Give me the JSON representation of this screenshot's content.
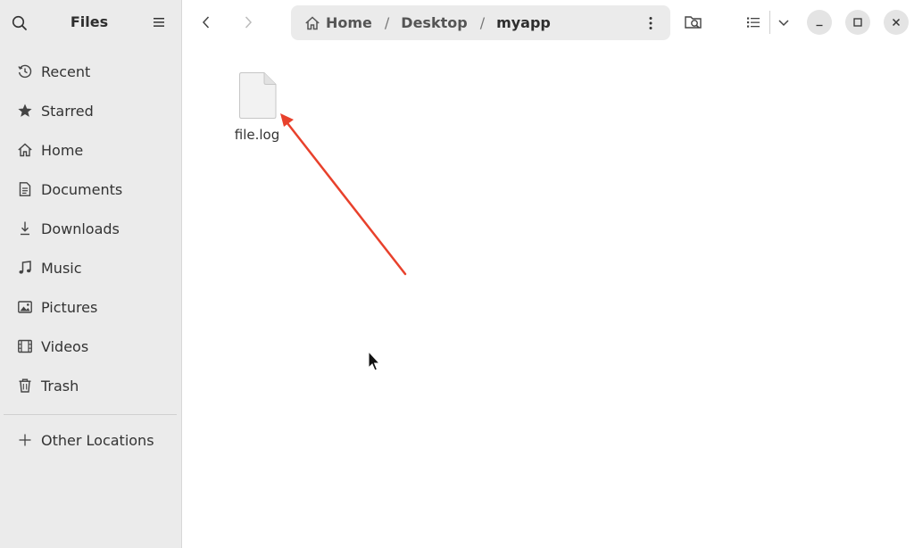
{
  "sidebar": {
    "title": "Files",
    "items": [
      {
        "label": "Recent",
        "icon": "clock-icon"
      },
      {
        "label": "Starred",
        "icon": "star-icon"
      },
      {
        "label": "Home",
        "icon": "home-icon"
      },
      {
        "label": "Documents",
        "icon": "document-icon"
      },
      {
        "label": "Downloads",
        "icon": "download-icon"
      },
      {
        "label": "Music",
        "icon": "music-icon"
      },
      {
        "label": "Pictures",
        "icon": "picture-icon"
      },
      {
        "label": "Videos",
        "icon": "video-icon"
      },
      {
        "label": "Trash",
        "icon": "trash-icon"
      }
    ],
    "other_locations": "Other Locations"
  },
  "pathbar": {
    "crumbs": [
      "Home",
      "Desktop",
      "myapp"
    ]
  },
  "content": {
    "files": [
      {
        "name": "file.log"
      }
    ]
  },
  "colors": {
    "sidebar_bg": "#ebebeb",
    "pathbar_bg": "#ebebeb",
    "annotation_arrow": "#e8412c"
  }
}
